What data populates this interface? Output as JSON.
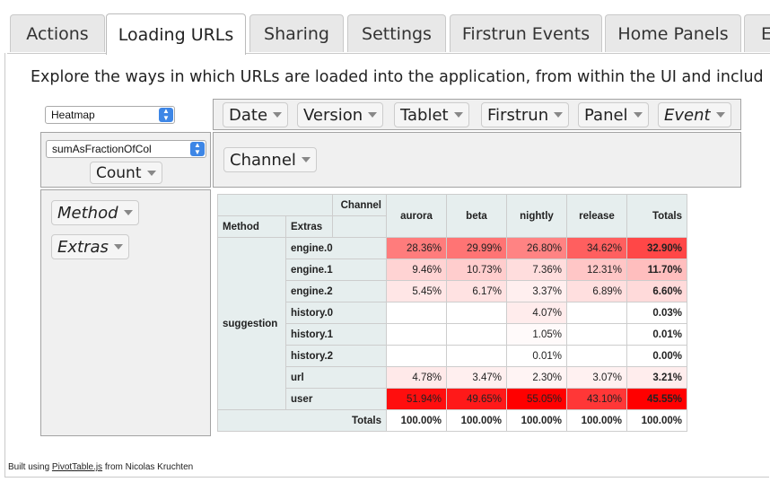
{
  "tabs": [
    "Actions",
    "Loading URLs",
    "Sharing",
    "Settings",
    "Firstrun Events",
    "Home Panels",
    "E"
  ],
  "active_tab": "Loading URLs",
  "description": "Explore the ways in which URLs are loaded into the application, from within the UI and includ",
  "renderer": {
    "selected": "Heatmap"
  },
  "aggregator": {
    "selected": "sumAsFractionOfCol",
    "value_attr": "Count"
  },
  "unused_attrs": [
    {
      "label": "Date",
      "italic": false
    },
    {
      "label": "Version",
      "italic": false
    },
    {
      "label": "Tablet",
      "italic": false
    },
    {
      "label": "Firstrun",
      "italic": false
    },
    {
      "label": "Panel",
      "italic": false
    },
    {
      "label": "Event",
      "italic": true
    }
  ],
  "col_attrs": [
    {
      "label": "Channel",
      "italic": false
    }
  ],
  "row_attrs": [
    {
      "label": "Method",
      "italic": true
    },
    {
      "label": "Extras",
      "italic": true
    }
  ],
  "table": {
    "col_header_label": "Channel",
    "row_header_labels": [
      "Method",
      "Extras"
    ],
    "columns": [
      "aurora",
      "beta",
      "nightly",
      "release"
    ],
    "totals_label": "Totals",
    "method_group": "suggestion",
    "rows": [
      {
        "extra": "engine.0",
        "values": [
          "28.36%",
          "29.99%",
          "26.80%",
          "34.62%"
        ],
        "total": "32.90%"
      },
      {
        "extra": "engine.1",
        "values": [
          "9.46%",
          "10.73%",
          "7.36%",
          "12.31%"
        ],
        "total": "11.70%"
      },
      {
        "extra": "engine.2",
        "values": [
          "5.45%",
          "6.17%",
          "3.37%",
          "6.89%"
        ],
        "total": "6.60%"
      },
      {
        "extra": "history.0",
        "values": [
          "",
          "",
          "4.07%",
          ""
        ],
        "total": "0.03%"
      },
      {
        "extra": "history.1",
        "values": [
          "",
          "",
          "1.05%",
          ""
        ],
        "total": "0.01%"
      },
      {
        "extra": "history.2",
        "values": [
          "",
          "",
          "0.01%",
          ""
        ],
        "total": "0.00%"
      },
      {
        "extra": "url",
        "values": [
          "4.78%",
          "3.47%",
          "2.30%",
          "3.07%"
        ],
        "total": "3.21%"
      },
      {
        "extra": "user",
        "values": [
          "51.94%",
          "49.65%",
          "55.05%",
          "43.10%"
        ],
        "total": "45.55%"
      }
    ],
    "totals_row": [
      "100.00%",
      "100.00%",
      "100.00%",
      "100.00%",
      "100.00%"
    ]
  },
  "footer": {
    "prefix": "Built using ",
    "link": "PivotTable.js",
    "suffix": " from Nicolas Kruchten"
  },
  "colors": {
    "heat_max": "#ff0000",
    "heat_min": "#ffffff",
    "select_arrow": "#3d86e6"
  }
}
